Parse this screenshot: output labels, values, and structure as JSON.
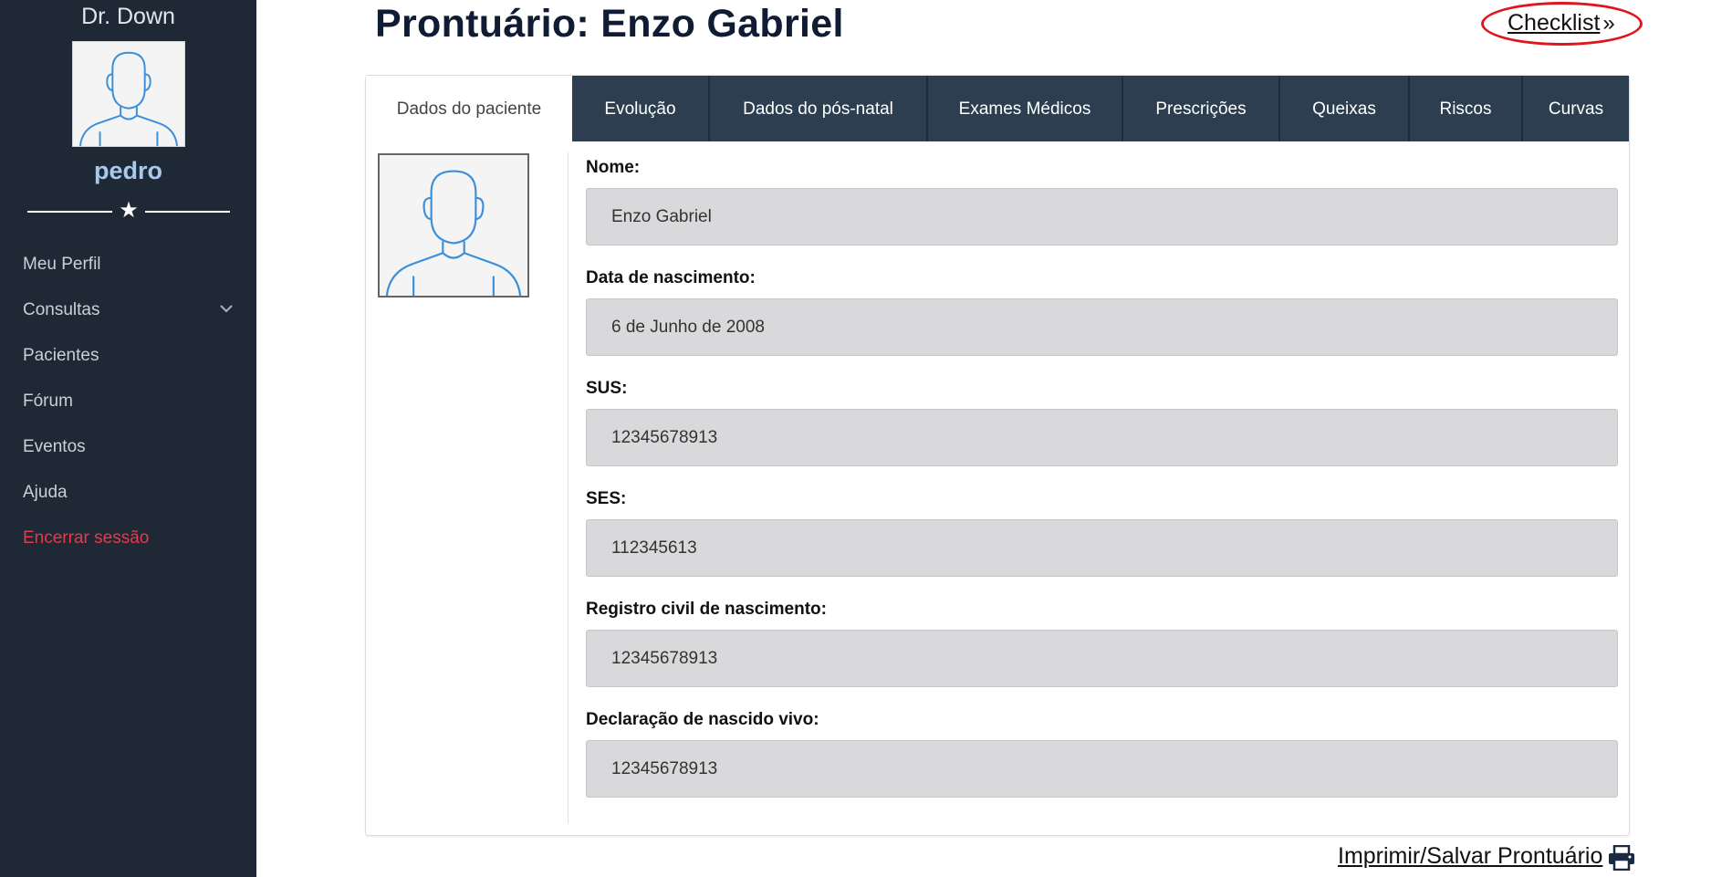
{
  "sidebar": {
    "brand": "Dr. Down",
    "username": "pedro",
    "divider_icon": "star-icon",
    "menu": [
      {
        "label": "Meu Perfil"
      },
      {
        "label": "Consultas",
        "has_submenu": true
      },
      {
        "label": "Pacientes"
      },
      {
        "label": "Fórum"
      },
      {
        "label": "Eventos"
      },
      {
        "label": "Ajuda"
      },
      {
        "label": "Encerrar sessão",
        "color": "#e8394a"
      }
    ]
  },
  "header": {
    "title": "Prontuário: Enzo Gabriel",
    "checklist_label": "Checklist",
    "checklist_icon": "double-chevron-right-icon",
    "highlight_color": "#e0141c"
  },
  "tabs": [
    {
      "label": "Dados do paciente",
      "active": true
    },
    {
      "label": "Evolução"
    },
    {
      "label": "Dados do pós-natal"
    },
    {
      "label": "Exames Médicos"
    },
    {
      "label": "Prescrições"
    },
    {
      "label": "Queixas"
    },
    {
      "label": "Riscos"
    },
    {
      "label": "Curvas"
    }
  ],
  "patient": {
    "fields": [
      {
        "label": "Nome:",
        "value": "Enzo Gabriel"
      },
      {
        "label": "Data de nascimento:",
        "value": "6 de Junho de 2008"
      },
      {
        "label": "SUS:",
        "value": "12345678913"
      },
      {
        "label": "SES:",
        "value": "112345613"
      },
      {
        "label": "Registro civil de nascimento:",
        "value": "12345678913"
      },
      {
        "label": "Declaração de nascido vivo:",
        "value": "12345678913"
      }
    ]
  },
  "footer": {
    "print_label": "Imprimir/Salvar Prontuário",
    "print_icon": "printer-icon"
  },
  "colors": {
    "sidebar_bg": "#1e2935",
    "tab_bg": "#2c3e50",
    "title": "#0f1c33",
    "username": "#a8c8ee",
    "logout": "#e8394a",
    "input_bg": "#d9d9db"
  }
}
